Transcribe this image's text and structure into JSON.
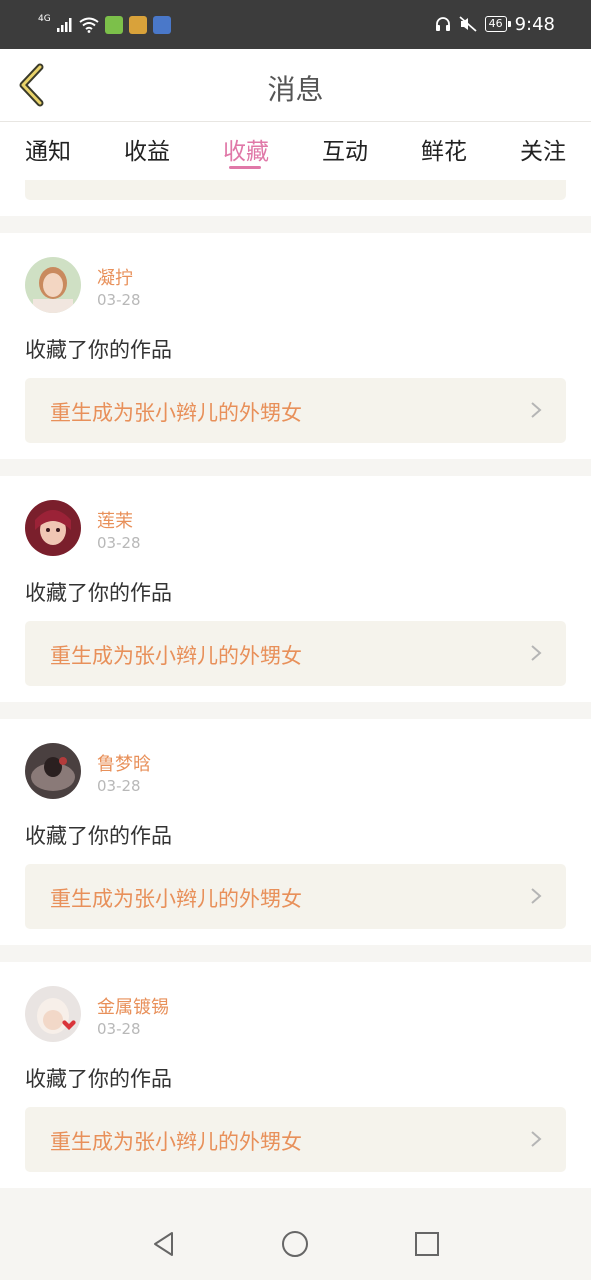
{
  "status_bar": {
    "network": "4G",
    "battery": "46",
    "time": "9:48"
  },
  "header": {
    "title": "消息"
  },
  "tabs": [
    {
      "label": "通知"
    },
    {
      "label": "收益"
    },
    {
      "label": "收藏",
      "active": true
    },
    {
      "label": "互动"
    },
    {
      "label": "鲜花"
    },
    {
      "label": "关注"
    }
  ],
  "colors": {
    "accent_pink": "#e078a8",
    "name_orange": "#e8905a",
    "card_tint": "#f5f3ec"
  },
  "items": [
    {
      "username": "凝拧",
      "date": "03-28",
      "message": "收藏了你的作品",
      "work_title": "重生成为张小辫儿的外甥女"
    },
    {
      "username": "莲茉",
      "date": "03-28",
      "message": "收藏了你的作品",
      "work_title": "重生成为张小辫儿的外甥女"
    },
    {
      "username": "鲁梦晗",
      "date": "03-28",
      "message": "收藏了你的作品",
      "work_title": "重生成为张小辫儿的外甥女"
    },
    {
      "username": "金属镀锡",
      "date": "03-28",
      "message": "收藏了你的作品",
      "work_title": "重生成为张小辫儿的外甥女"
    }
  ],
  "icons": {
    "back": "chevron-left-icon",
    "item_arrow": "chevron-right-icon",
    "nav_back": "triangle-back-icon",
    "nav_home": "circle-home-icon",
    "nav_recent": "square-recent-icon"
  }
}
